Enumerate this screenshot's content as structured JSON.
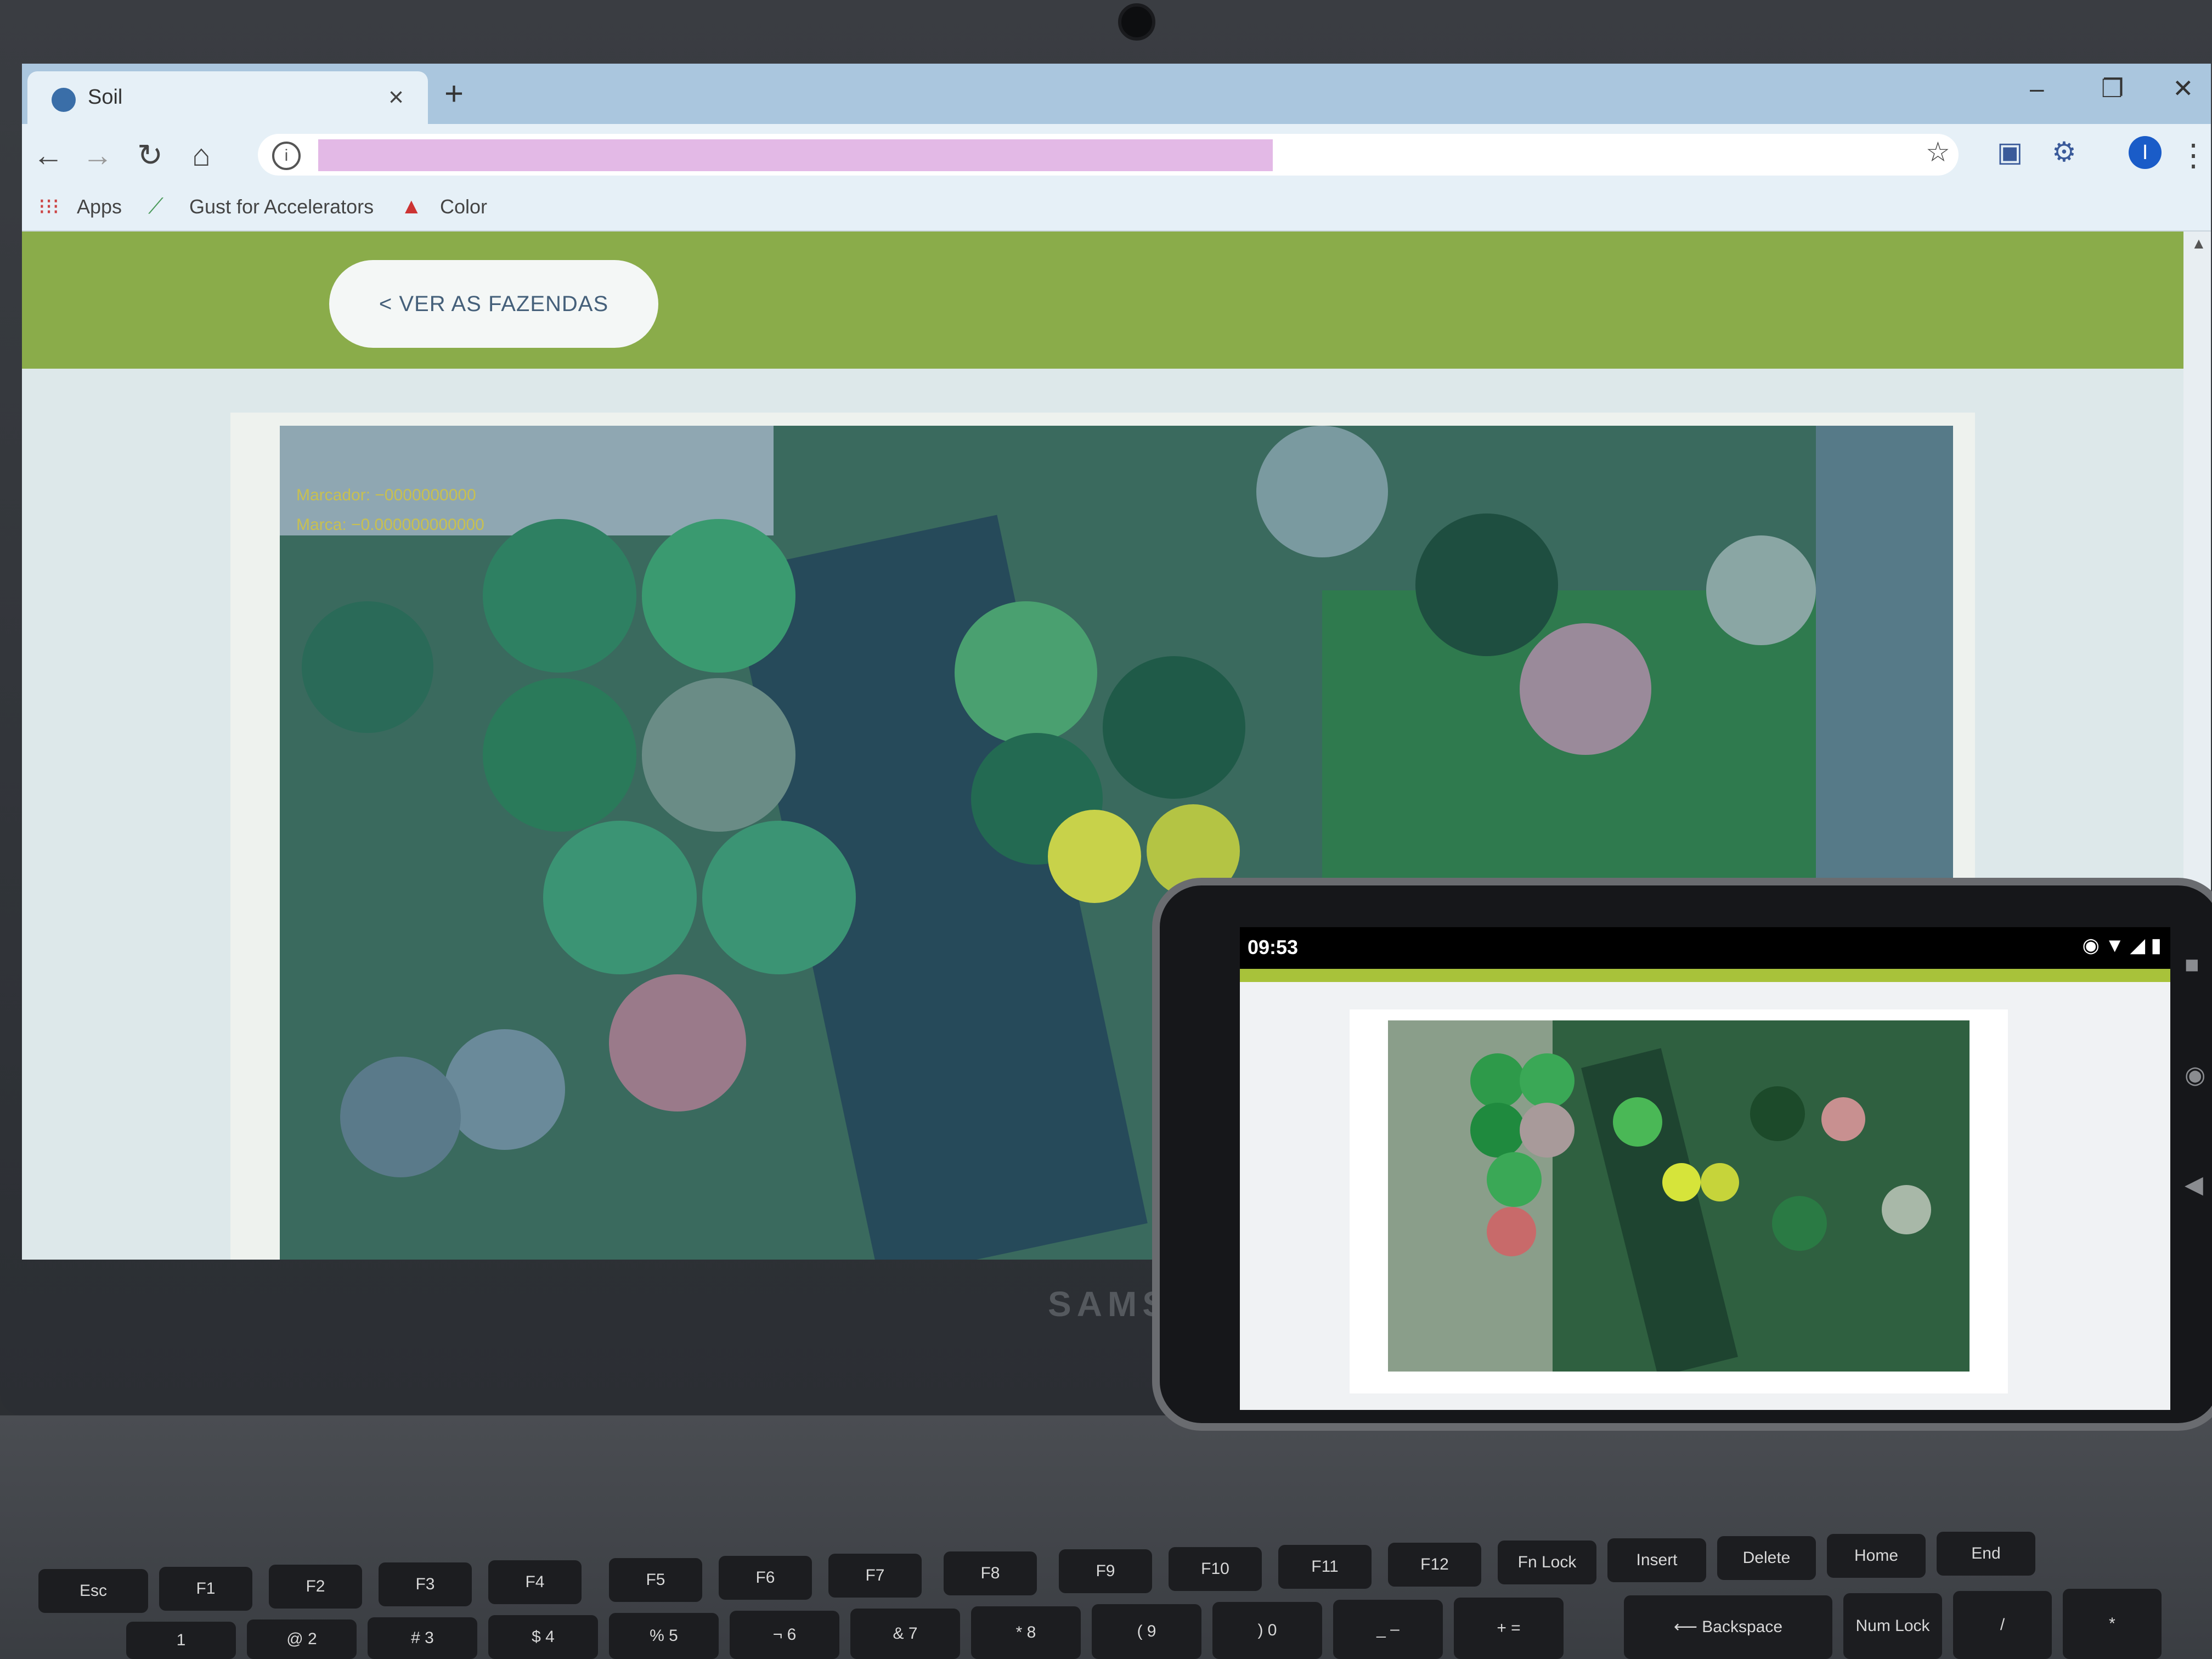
{
  "browser": {
    "tab_title": "Soil",
    "tab_close": "×",
    "new_tab": "+",
    "win_minimize": "–",
    "win_restore": "❐",
    "win_close": "✕",
    "back": "←",
    "forward": "→",
    "reload": "↻",
    "home": "⌂",
    "info": "i",
    "star": "☆",
    "profile": "I",
    "menu": "⋮",
    "bookmarks": [
      {
        "label": "Apps"
      },
      {
        "label": "Gust for Accelerators"
      },
      {
        "label": "Color"
      }
    ]
  },
  "page": {
    "back_button_label": "< VER AS FAZENDAS",
    "map_lines": [
      "Marcador: −0000000000",
      "Marca: −0.000000000000"
    ]
  },
  "laptop": {
    "brand": "SAMS"
  },
  "phone": {
    "time": "09:53",
    "status_icons": "◉ ▼ ◢ ▮"
  },
  "keyboard": {
    "row1": [
      "Esc",
      "F1",
      "F2",
      "F3",
      "F4",
      "F5",
      "F6",
      "F7",
      "F8",
      "F9",
      "F10",
      "F11",
      "F12",
      "Fn Lock",
      "Insert",
      "Delete",
      "Home",
      "End"
    ],
    "row2": [
      "!",
      "1",
      "@ 2",
      "# 3",
      "$ 4",
      "% 5",
      "¬ 6",
      "& 7",
      "* 8",
      "( 9",
      ") 0",
      "_ –",
      "+ =",
      "⟵ Backspace",
      "Num Lock",
      "/",
      "*"
    ]
  },
  "colors": {
    "header_green": "#8aac4a",
    "footer_blue": "#26407a",
    "button_bg": "#f4f7f6",
    "button_text": "#45607a"
  }
}
